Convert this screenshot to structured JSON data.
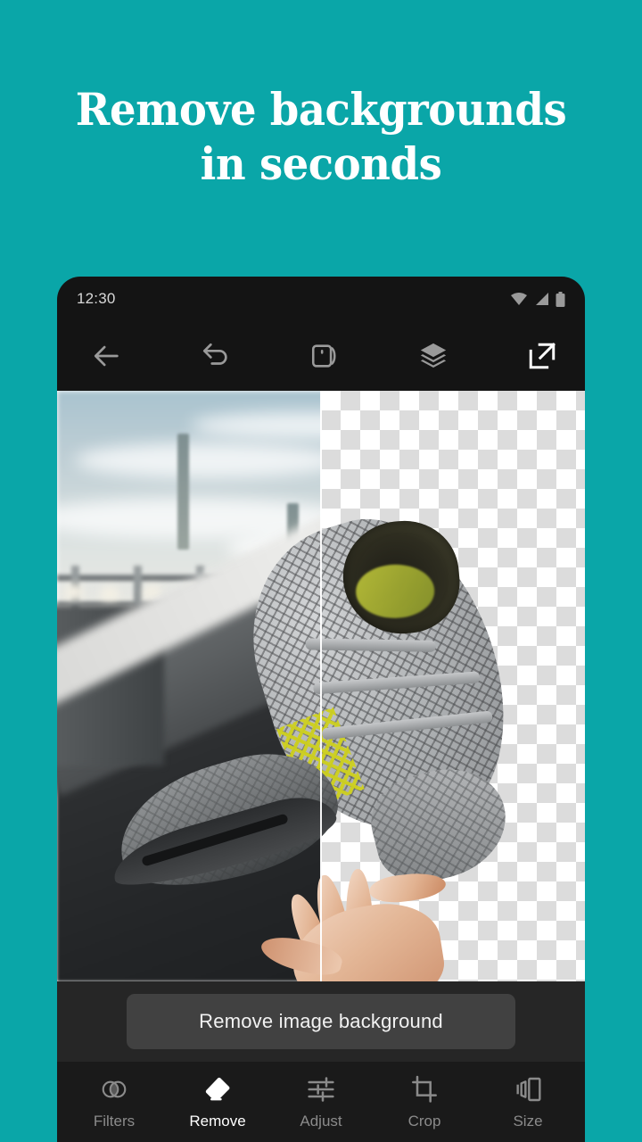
{
  "promo": {
    "headline": "Remove backgrounds\nin seconds",
    "background_color": "#0aa6a8",
    "text_color": "#ffffff"
  },
  "phone": {
    "status_bar": {
      "time": "12:30",
      "icons": [
        "wifi-icon",
        "cellular-signal-icon",
        "battery-icon"
      ]
    },
    "toolbar": {
      "items": [
        {
          "name": "back-button",
          "icon": "arrow-left-icon",
          "active": false
        },
        {
          "name": "undo-button",
          "icon": "undo-icon",
          "active": false
        },
        {
          "name": "compare-button",
          "icon": "compare-icon",
          "active": false
        },
        {
          "name": "layers-button",
          "icon": "layers-icon",
          "active": false
        },
        {
          "name": "export-button",
          "icon": "export-icon",
          "active": true
        }
      ],
      "inactive_color": "#9a9a9a",
      "active_color": "#ffffff"
    },
    "canvas": {
      "split_view": true,
      "left_pane": "original-photo",
      "right_pane": "transparent-checkerboard",
      "subject": "grey mesh sneaker tossed above an open hand",
      "checker_color": "#dcdcdc"
    },
    "cta": {
      "label": "Remove image background",
      "background": "#414141",
      "text_color": "#f2f2f2"
    },
    "nav": {
      "items": [
        {
          "label": "Filters",
          "icon": "filters-icon",
          "active": false
        },
        {
          "label": "Remove",
          "icon": "eraser-icon",
          "active": true
        },
        {
          "label": "Adjust",
          "icon": "sliders-icon",
          "active": false
        },
        {
          "label": "Crop",
          "icon": "crop-icon",
          "active": false
        },
        {
          "label": "Size",
          "icon": "resize-icon",
          "active": false
        }
      ]
    }
  }
}
